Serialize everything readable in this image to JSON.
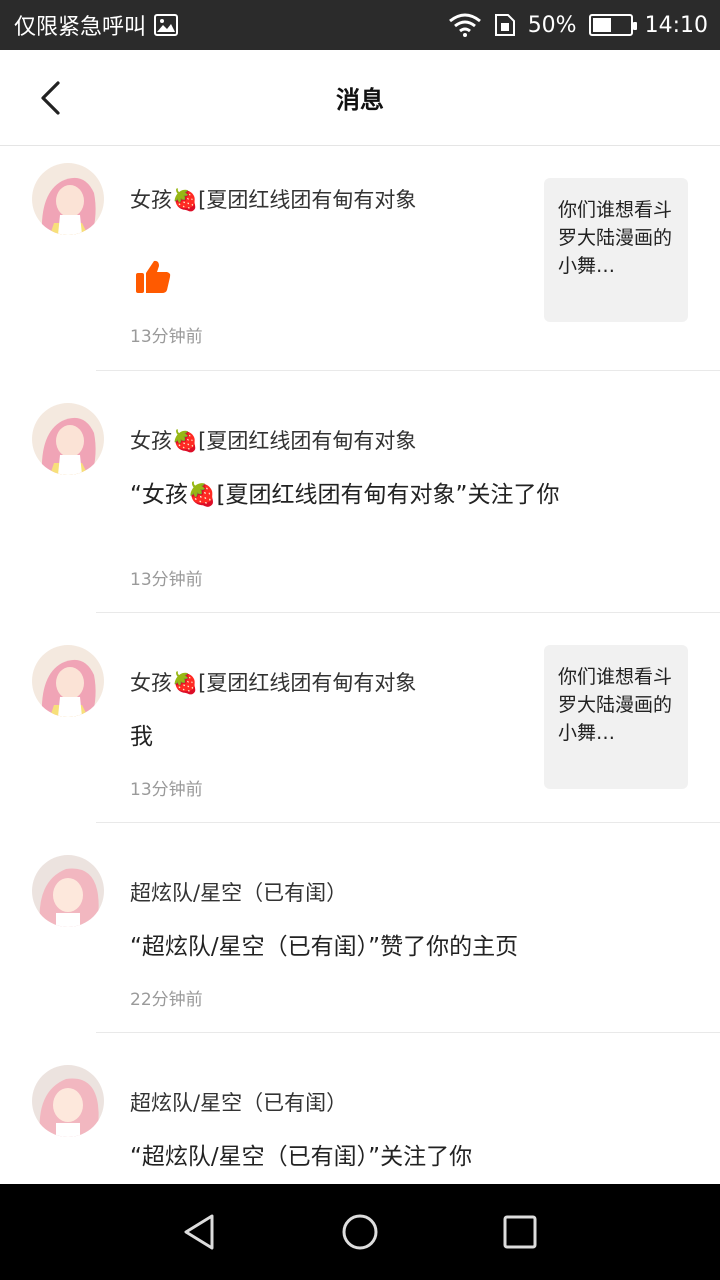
{
  "status_bar": {
    "carrier": "仅限紧急呼叫",
    "battery": "50%",
    "time": "14:10"
  },
  "header": {
    "title": "消息"
  },
  "messages": [
    {
      "username": "女孩🍓[夏团红线团有甸有对象",
      "content": "",
      "content_icon": "thumbs-up-icon",
      "time": "13分钟前",
      "thumb_text": "你们谁想看斗罗大陆漫画的小舞…"
    },
    {
      "username": "女孩🍓[夏团红线团有甸有对象",
      "content": "“女孩🍓[夏团红线团有甸有对象”关注了你",
      "time": "13分钟前"
    },
    {
      "username": "女孩🍓[夏团红线团有甸有对象",
      "content": "我",
      "time": "13分钟前",
      "thumb_text": "你们谁想看斗罗大陆漫画的小舞…"
    },
    {
      "username": "超炫队/星空（已有闺）",
      "content": "“超炫队/星空（已有闺）”赞了你的主页",
      "time": "22分钟前"
    },
    {
      "username": "超炫队/星空（已有闺）",
      "content": "“超炫队/星空（已有闺）”关注了你",
      "time": ""
    }
  ],
  "colors": {
    "status_bar_bg": "#2b2b2b",
    "accent_orange": "#ff5a00",
    "nav_bar_bg": "#000000"
  }
}
